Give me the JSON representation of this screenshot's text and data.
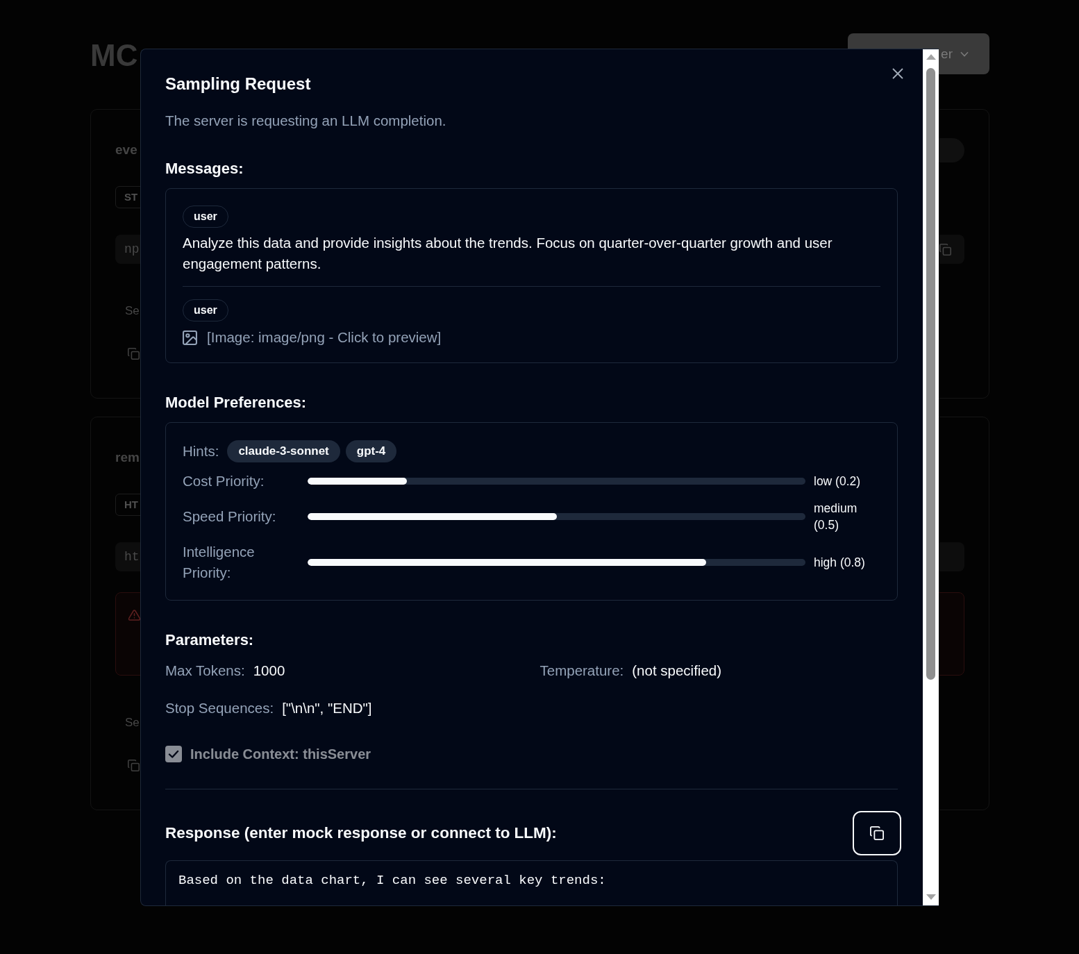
{
  "page": {
    "title": "MC",
    "menu_button": {
      "label": "er"
    },
    "cards": [
      {
        "kind": "status",
        "title": "eve",
        "badge": "ST",
        "command": "np",
        "section_label": "Se"
      },
      {
        "kind": "error",
        "title": "rem",
        "badge": "HT",
        "command": "ht",
        "section_label": "Se"
      }
    ]
  },
  "dialog": {
    "title": "Sampling Request",
    "description": "The server is requesting an LLM completion.",
    "messages_heading": "Messages:",
    "messages": [
      {
        "kind": "text",
        "role": "user",
        "text": "Analyze this data and provide insights about the trends. Focus on quarter-over-quarter growth and user engagement patterns."
      },
      {
        "kind": "image",
        "role": "user",
        "text": "[Image: image/png - Click to preview]"
      }
    ],
    "preferences_heading": "Model Preferences:",
    "hints_label": "Hints:",
    "hints": [
      "claude-3-sonnet",
      "gpt-4"
    ],
    "priorities": [
      {
        "label": "Cost Priority:",
        "level": 0.2,
        "reading": "low (0.2)"
      },
      {
        "label": "Speed Priority:",
        "level": 0.5,
        "reading": "medium (0.5)"
      },
      {
        "label": "Intelligence Priority:",
        "level": 0.8,
        "reading": "high (0.8)"
      }
    ],
    "parameters_heading": "Parameters:",
    "parameters": [
      {
        "label": "Max Tokens:",
        "value": "1000"
      },
      {
        "label": "Temperature:",
        "value": "(not specified)"
      },
      {
        "label": "Stop Sequences:",
        "value": "[\"\\n\\n\", \"END\"]"
      }
    ],
    "include_context": {
      "label": "Include Context: thisServer",
      "checked": true,
      "disabled": true
    },
    "response_heading": "Response (enter mock response or connect to LLM):",
    "response": {
      "value": "Based on the data chart, I can see several key trends:"
    }
  }
}
